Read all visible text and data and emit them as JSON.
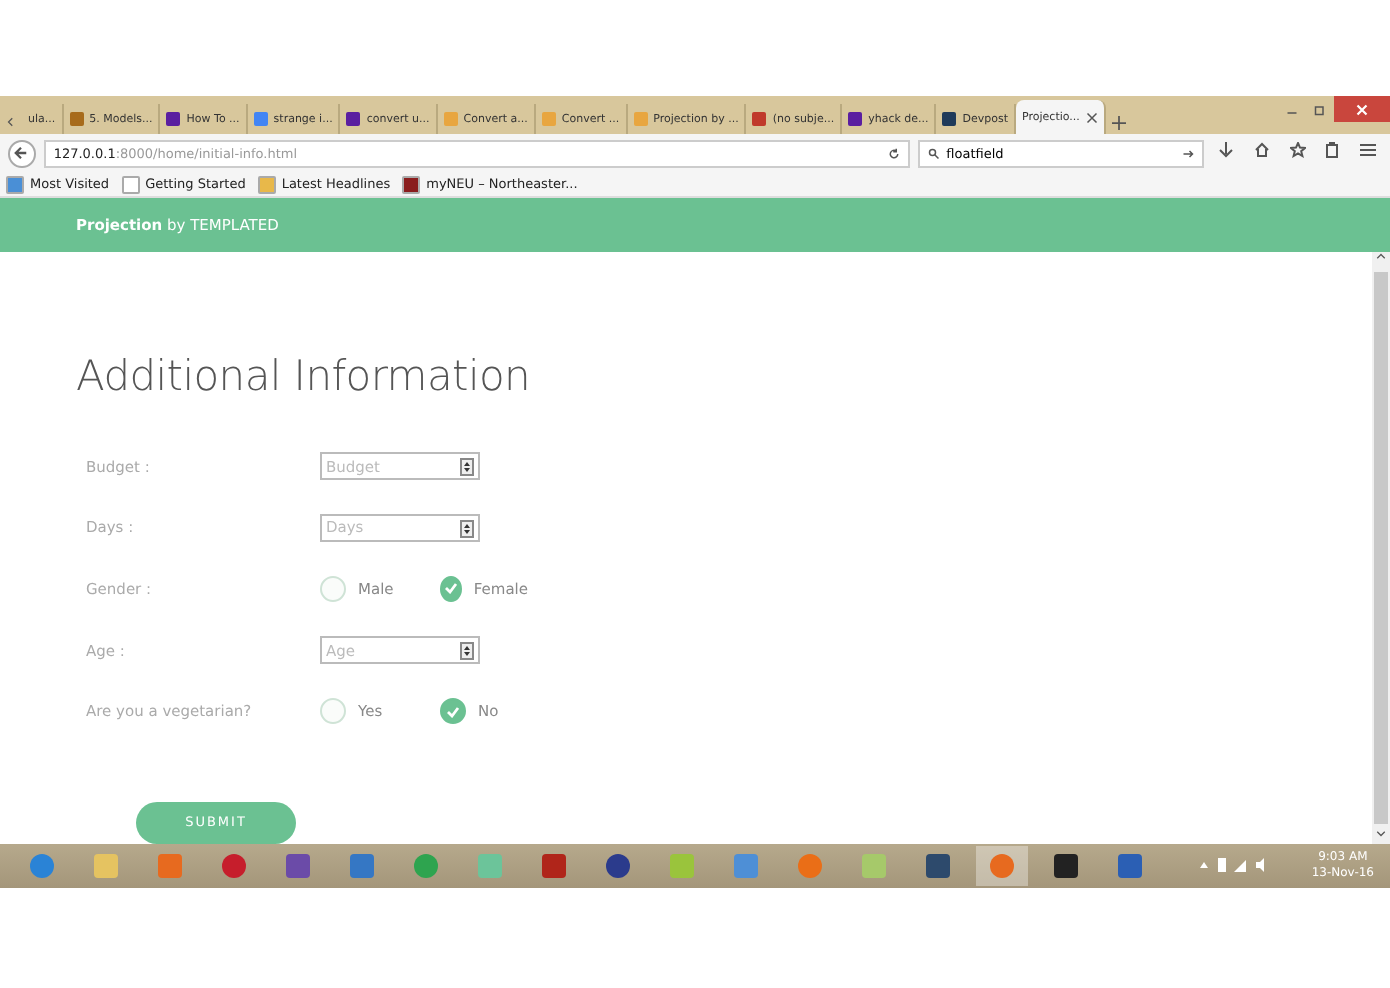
{
  "browser": {
    "tabs": [
      {
        "label": "ula...",
        "selected": false
      },
      {
        "label": "5. Models...",
        "selected": false
      },
      {
        "label": "How To ...",
        "selected": false
      },
      {
        "label": "strange i...",
        "selected": false
      },
      {
        "label": "convert u...",
        "selected": false
      },
      {
        "label": "Convert a...",
        "selected": false
      },
      {
        "label": "Convert ...",
        "selected": false
      },
      {
        "label": "Projection by ...",
        "selected": false
      },
      {
        "label": "(no subje...",
        "selected": false
      },
      {
        "label": "yhack de...",
        "selected": false
      },
      {
        "label": "Devpost",
        "selected": false
      },
      {
        "label": "Projectio...",
        "selected": true
      }
    ],
    "url_host": "127.0.0.1",
    "url_rest": ":8000/home/initial-info.html",
    "search": "floatfield",
    "bookmarks": [
      "Most Visited",
      "Getting Started",
      "Latest Headlines",
      "myNEU – Northeaster..."
    ]
  },
  "header": {
    "brand": "Projection",
    "suffix": "by TEMPLATED"
  },
  "form": {
    "title": "Additional Information",
    "rows": [
      {
        "kind": "number",
        "label": "Budget :",
        "placeholder": "Budget"
      },
      {
        "kind": "number",
        "label": "Days :",
        "placeholder": "Days"
      },
      {
        "kind": "radio",
        "label": "Gender :",
        "options": [
          {
            "label": "Male",
            "selected": false
          },
          {
            "label": "Female",
            "selected": true
          }
        ]
      },
      {
        "kind": "number",
        "label": "Age :",
        "placeholder": "Age"
      },
      {
        "kind": "radio",
        "label": "Are you a vegetarian?",
        "options": [
          {
            "label": "Yes",
            "selected": false
          },
          {
            "label": "No",
            "selected": true
          }
        ]
      }
    ],
    "submit": "SUBMIT"
  },
  "taskbar": {
    "time": "9:03 AM",
    "date": "13-Nov-16"
  }
}
